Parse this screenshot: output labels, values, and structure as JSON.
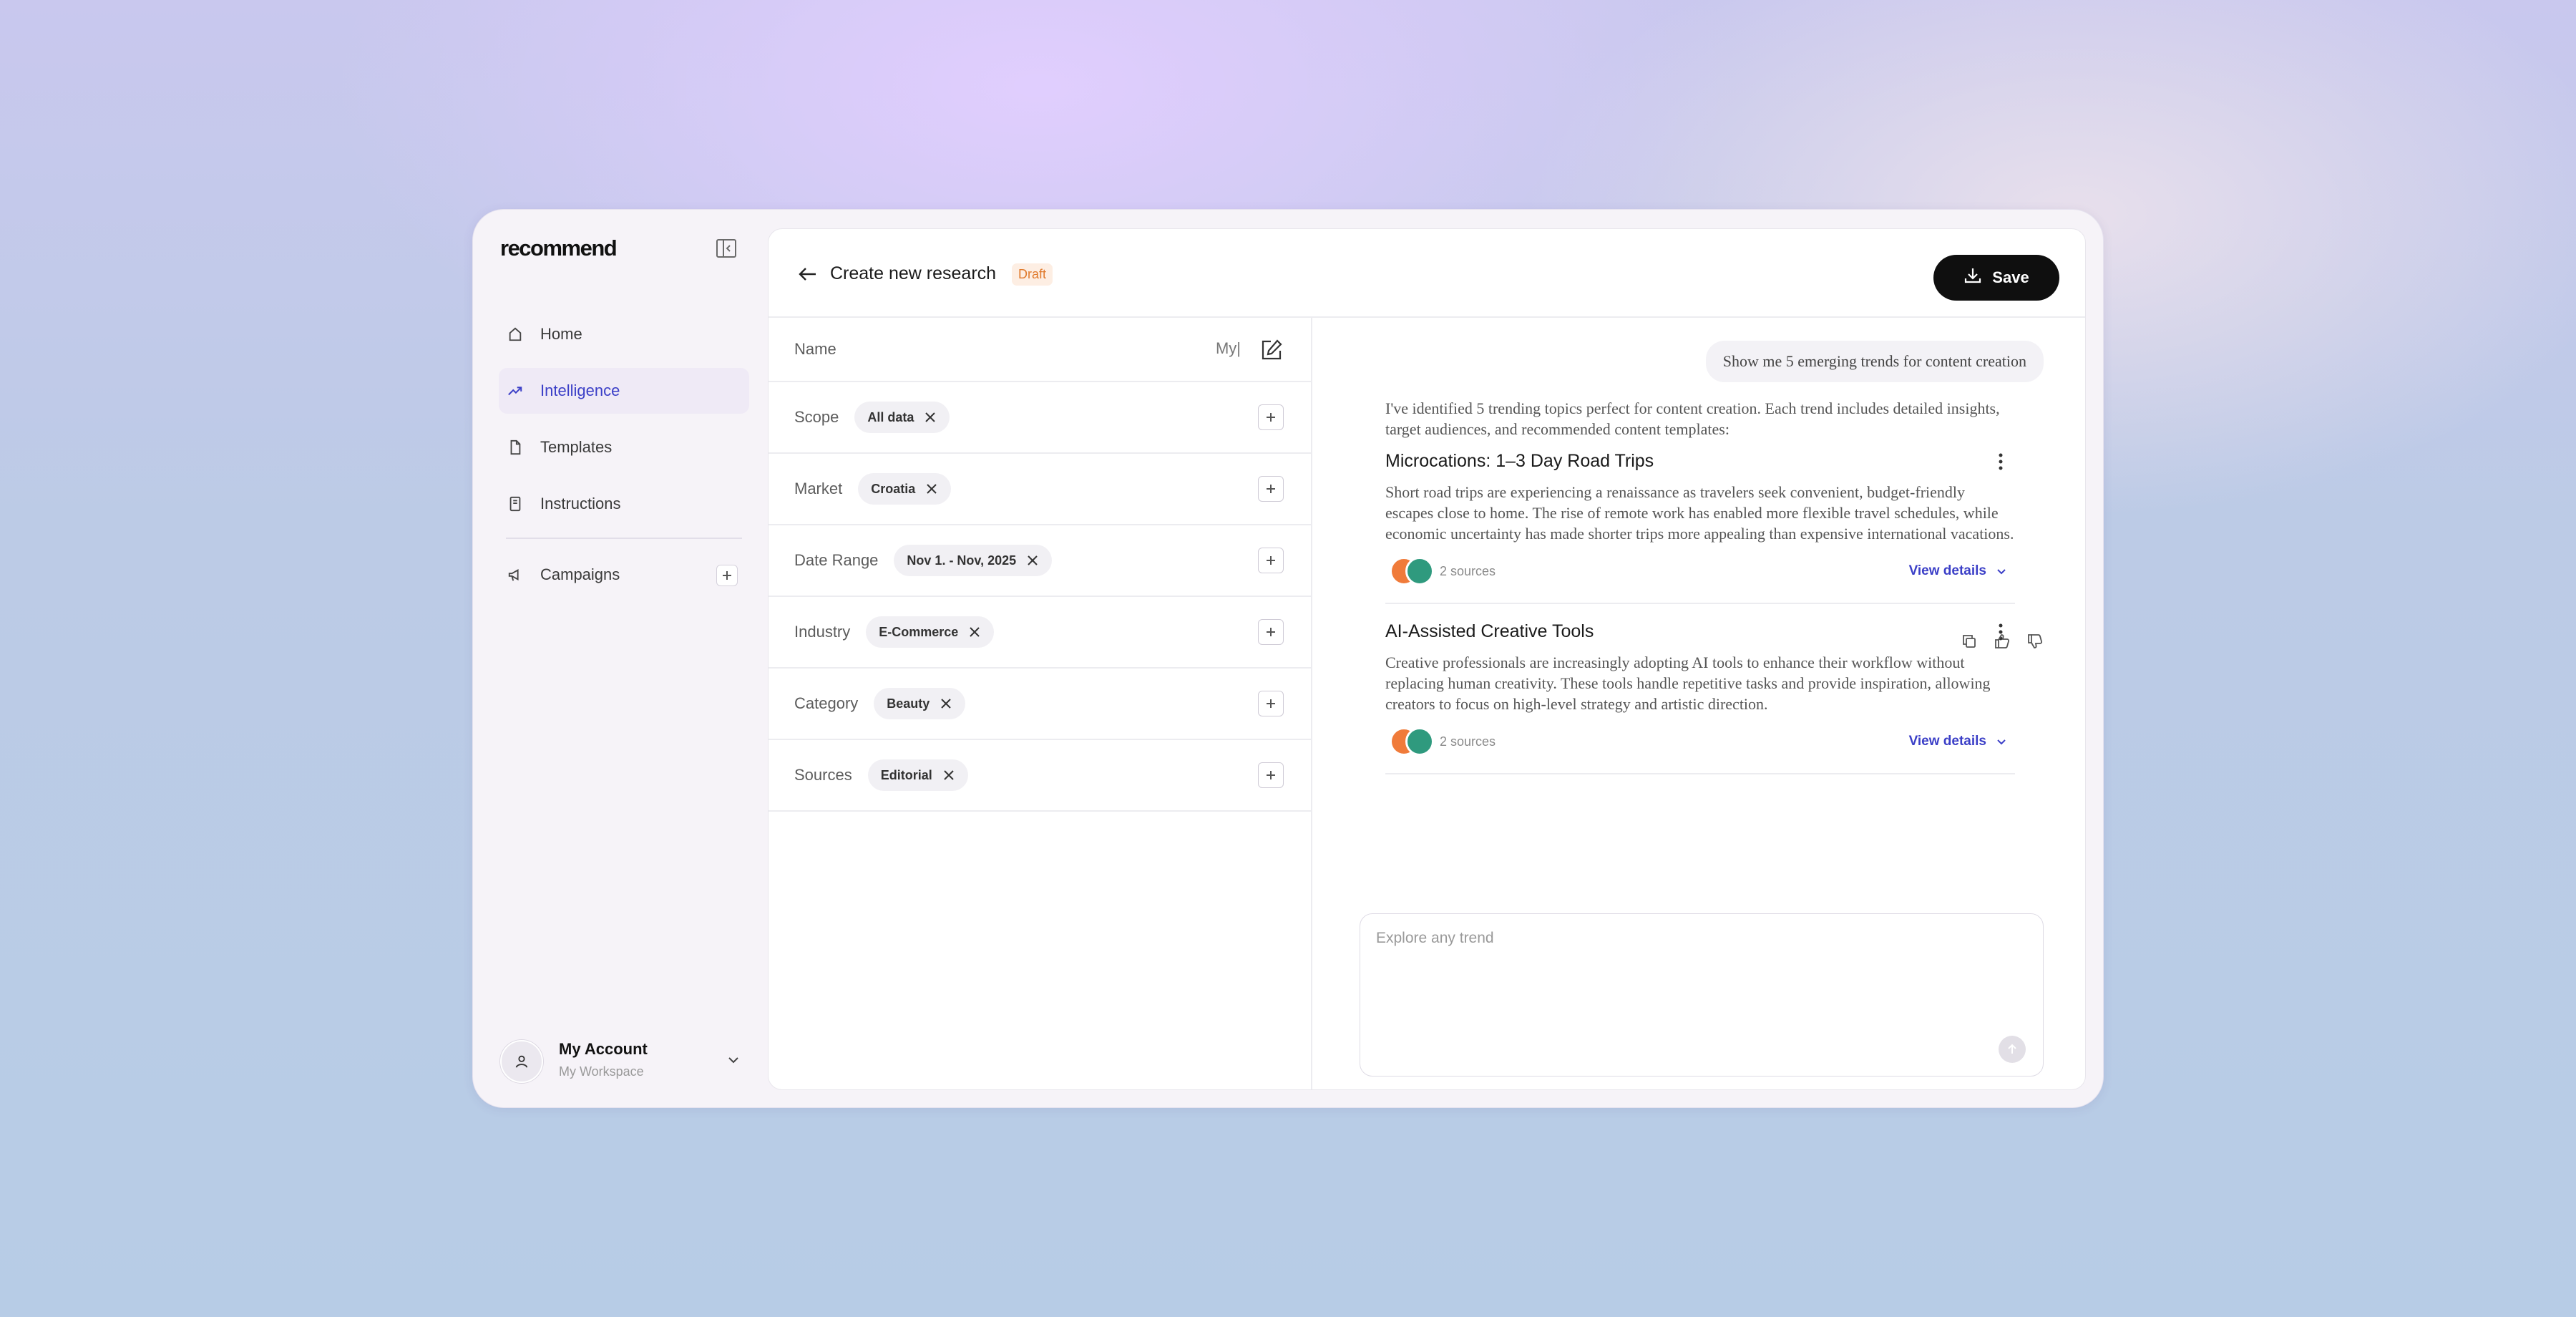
{
  "app": {
    "logo": "recommend"
  },
  "sidebar": {
    "items": [
      {
        "label": "Home",
        "icon": "home-icon"
      },
      {
        "label": "Intelligence",
        "icon": "trending-up-icon",
        "active": true
      },
      {
        "label": "Templates",
        "icon": "file-icon"
      },
      {
        "label": "Instructions",
        "icon": "book-icon"
      },
      {
        "label": "Campaigns",
        "icon": "megaphone-icon"
      }
    ],
    "account": {
      "name": "My Account",
      "workspace": "My Workspace"
    }
  },
  "header": {
    "title": "Create new research",
    "status_badge": "Draft",
    "save_label": "Save"
  },
  "form": {
    "name": {
      "label": "Name",
      "value": "My|"
    },
    "fields": [
      {
        "label": "Scope",
        "chip": "All data"
      },
      {
        "label": "Market",
        "chip": "Croatia"
      },
      {
        "label": "Date Range",
        "chip": "Nov 1. - Nov, 2025"
      },
      {
        "label": "Industry",
        "chip": "E-Commerce"
      },
      {
        "label": "Category",
        "chip": "Beauty"
      },
      {
        "label": "Sources",
        "chip": "Editorial"
      }
    ]
  },
  "chat": {
    "user_message": "Show me 5 emerging trends for content creation",
    "intro": "I've identified 5 trending topics perfect for content creation. Each trend includes detailed insights, target audiences, and recommended content templates:",
    "trends": [
      {
        "title": "Microcations: 1–3 Day Road Trips",
        "body": "Short road trips are experiencing a renaissance as travelers seek convenient, budget-friendly escapes close to home. The rise of remote work has enabled more flexible travel schedules, while economic uncertainty has made shorter trips more appealing than expensive international vacations.",
        "sources": "2 sources",
        "details_label": "View details"
      },
      {
        "title": "AI-Assisted Creative Tools",
        "body": "Creative professionals are increasingly adopting AI tools to enhance their workflow without replacing human creativity. These tools handle repetitive tasks and provide inspiration, allowing creators to focus on high-level strategy and artistic direction.",
        "sources": "2 sources",
        "details_label": "View details"
      }
    ],
    "composer_placeholder": "Explore any trend"
  },
  "colors": {
    "accent": "#3b3fc7",
    "draft": "#e07a2c",
    "source_orange": "#f07b3a",
    "source_green": "#2f9a7e"
  }
}
